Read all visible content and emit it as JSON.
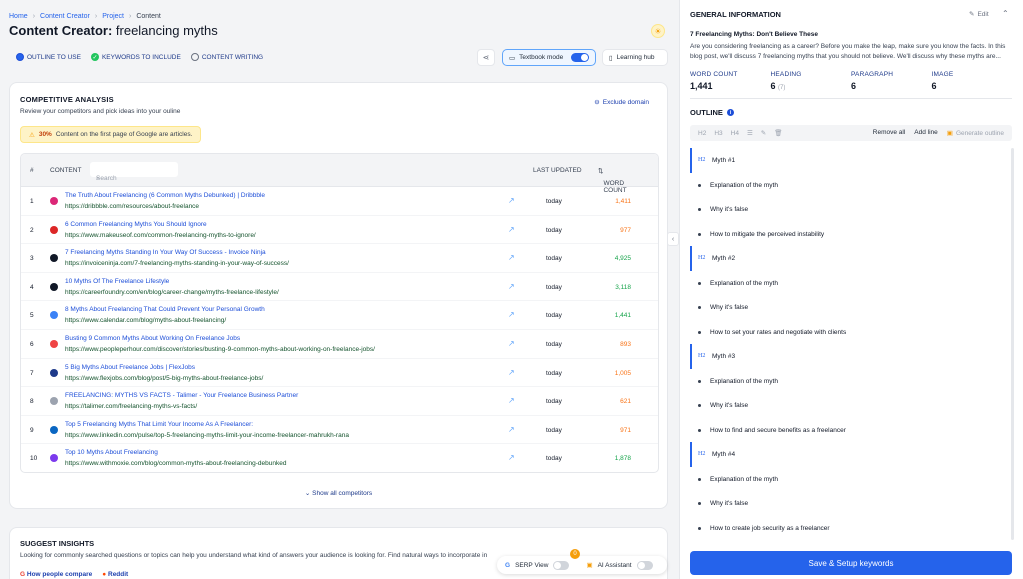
{
  "breadcrumb": [
    "Home",
    "Content Creator",
    "Project",
    "Content"
  ],
  "page_title": {
    "bold": "Content Creator:",
    "rest": " freelancing myths"
  },
  "steps": [
    {
      "label": "OUTLINE TO USE",
      "state": "active"
    },
    {
      "label": "KEYWORDS TO INCLUDE",
      "state": "done"
    },
    {
      "label": "CONTENT WRITING",
      "state": "todo"
    }
  ],
  "toolbar": {
    "textbook_mode": "Textbook mode",
    "learning_hub": "Learning hub"
  },
  "competitive": {
    "title": "COMPETITIVE ANALYSIS",
    "subtitle": "Review your competitors and pick ideas into your ouline",
    "exclude": "Exclude domain",
    "banner_pct": "30%",
    "banner_text": "Content on the first page of Google are articles.",
    "columns": {
      "index": "#",
      "content": "CONTENT",
      "search_placeholder": "Search",
      "updated": "LAST UPDATED",
      "wordcount": "WORD COUNT"
    },
    "rows": [
      {
        "n": "1",
        "title": "The Truth About Freelancing (6 Common Myths Debunked) | Dribbble",
        "url": "https://dribbble.com/resources/about-freelance",
        "updated": "today",
        "wc": "1,411",
        "wc_color": "#f97316",
        "fav": "#db2777"
      },
      {
        "n": "2",
        "title": "6 Common Freelancing Myths You Should Ignore",
        "url": "https://www.makeuseof.com/common-freelancing-myths-to-ignore/",
        "updated": "today",
        "wc": "977",
        "wc_color": "#f97316",
        "fav": "#dc2626"
      },
      {
        "n": "3",
        "title": "7 Freelancing Myths Standing In Your Way Of Success - Invoice Ninja",
        "url": "https://invoiceninja.com/7-freelancing-myths-standing-in-your-way-of-success/",
        "updated": "today",
        "wc": "4,925",
        "wc_color": "#16a34a",
        "fav": "#111827"
      },
      {
        "n": "4",
        "title": "10 Myths Of The Freelance Lifestyle",
        "url": "https://careerfoundry.com/en/blog/career-change/myths-freelance-lifestyle/",
        "updated": "today",
        "wc": "3,118",
        "wc_color": "#16a34a",
        "fav": "#111827"
      },
      {
        "n": "5",
        "title": "8 Myths About Freelancing That Could Prevent Your Personal Growth",
        "url": "https://www.calendar.com/blog/myths-about-freelancing/",
        "updated": "today",
        "wc": "1,441",
        "wc_color": "#16a34a",
        "fav": "#3b82f6"
      },
      {
        "n": "6",
        "title": "Busting 9 Common Myths About Working On Freelance Jobs",
        "url": "https://www.peopleperhour.com/discover/stories/busting-9-common-myths-about-working-on-freelance-jobs/",
        "updated": "today",
        "wc": "893",
        "wc_color": "#f97316",
        "fav": "#ef4444"
      },
      {
        "n": "7",
        "title": "5 Big Myths About Freelance Jobs | FlexJobs",
        "url": "https://www.flexjobs.com/blog/post/5-big-myths-about-freelance-jobs/",
        "updated": "today",
        "wc": "1,005",
        "wc_color": "#f97316",
        "fav": "#1e3a8a"
      },
      {
        "n": "8",
        "title": "FREELANCING: MYTHS VS FACTS - Talimer - Your Freelance Business Partner",
        "url": "https://talimer.com/freelancing-myths-vs-facts/",
        "updated": "today",
        "wc": "621",
        "wc_color": "#f97316",
        "fav": "#9ca3af"
      },
      {
        "n": "9",
        "title": "Top 5 Freelancing Myths That Limit Your Income As A Freelancer:",
        "url": "https://www.linkedin.com/pulse/top-5-freelancing-myths-limit-your-income-freelancer-mahrukh-rana",
        "updated": "today",
        "wc": "971",
        "wc_color": "#f97316",
        "fav": "#0a66c2"
      },
      {
        "n": "10",
        "title": "Top 10 Myths About Freelancing",
        "url": "https://www.withmoxie.com/blog/common-myths-about-freelancing-debunked",
        "updated": "today",
        "wc": "1,878",
        "wc_color": "#16a34a",
        "fav": "#7c3aed"
      }
    ],
    "show_all": "Show all competitors"
  },
  "insights": {
    "title": "SUGGEST INSIGHTS",
    "subtitle": "Looking for commonly searched questions or topics can help you understand what kind of answers your audience is looking for. Find natural ways to incorporate in",
    "links": [
      "How people compare",
      "Reddit"
    ]
  },
  "floatbar": {
    "serp": "SERP View",
    "ai": "AI Assistant",
    "badge": "0"
  },
  "general": {
    "title": "GENERAL INFORMATION",
    "edit": "Edit",
    "article_title": "7 Freelancing Myths: Don't Believe These",
    "description": "Are you considering freelancing as a career? Before you make the leap, make sure you know the facts. In this blog post, we'll discuss 7 freelancing myths that you should not believe. We'll discuss why these myths are...",
    "stats": [
      {
        "label": "WORD COUNT",
        "value": "1,441",
        "extra": ""
      },
      {
        "label": "HEADING",
        "value": "6",
        "extra": "(7)"
      },
      {
        "label": "PARAGRAPH",
        "value": "6",
        "extra": ""
      },
      {
        "label": "IMAGE",
        "value": "6",
        "extra": ""
      }
    ]
  },
  "outline": {
    "title": "OUTLINE",
    "tools": [
      "H2",
      "H3",
      "H4"
    ],
    "remove_all": "Remove all",
    "add_line": "Add line",
    "generate": "Generate outline",
    "items": [
      {
        "level": "H2",
        "text": "Myth #1"
      },
      {
        "level": "H3",
        "text": "Explanation of the myth"
      },
      {
        "level": "H3",
        "text": "Why it's false"
      },
      {
        "level": "H3",
        "text": "How to mitigate the perceived instability"
      },
      {
        "level": "H2",
        "text": "Myth #2"
      },
      {
        "level": "H3",
        "text": "Explanation of the myth"
      },
      {
        "level": "H3",
        "text": "Why it's false"
      },
      {
        "level": "H3",
        "text": "How to set your rates and negotiate with clients"
      },
      {
        "level": "H2",
        "text": "Myth #3"
      },
      {
        "level": "H3",
        "text": "Explanation of the myth"
      },
      {
        "level": "H3",
        "text": "Why it's false"
      },
      {
        "level": "H3",
        "text": "How to find and secure benefits as a freelancer"
      },
      {
        "level": "H2",
        "text": "Myth #4"
      },
      {
        "level": "H3",
        "text": "Explanation of the myth"
      },
      {
        "level": "H3",
        "text": "Why it's false"
      },
      {
        "level": "H3",
        "text": "How to create job security as a freelancer"
      }
    ]
  },
  "save_button": "Save & Setup keywords"
}
